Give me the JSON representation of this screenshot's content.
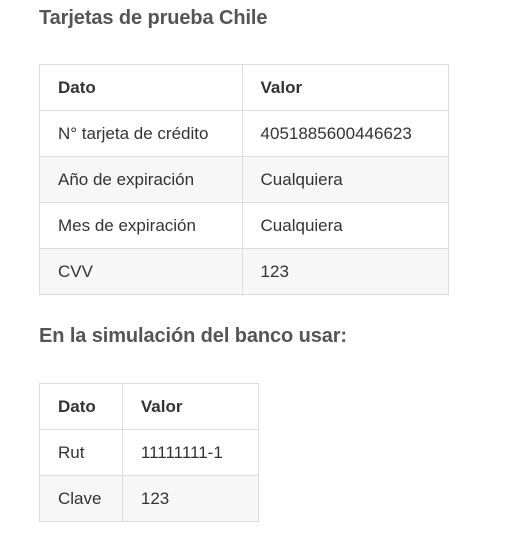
{
  "section1": {
    "title": "Tarjetas de prueba Chile",
    "headers": [
      "Dato",
      "Valor"
    ],
    "rows": [
      [
        "N° tarjeta de crédito",
        "4051885600446623"
      ],
      [
        "Año de expiración",
        "Cualquiera"
      ],
      [
        "Mes de expiración",
        "Cualquiera"
      ],
      [
        "CVV",
        "123"
      ]
    ]
  },
  "section2": {
    "title": "En la simulación del banco usar:",
    "headers": [
      "Dato",
      "Valor"
    ],
    "rows": [
      [
        "Rut",
        "11111111-1"
      ],
      [
        "Clave",
        "123"
      ]
    ]
  }
}
